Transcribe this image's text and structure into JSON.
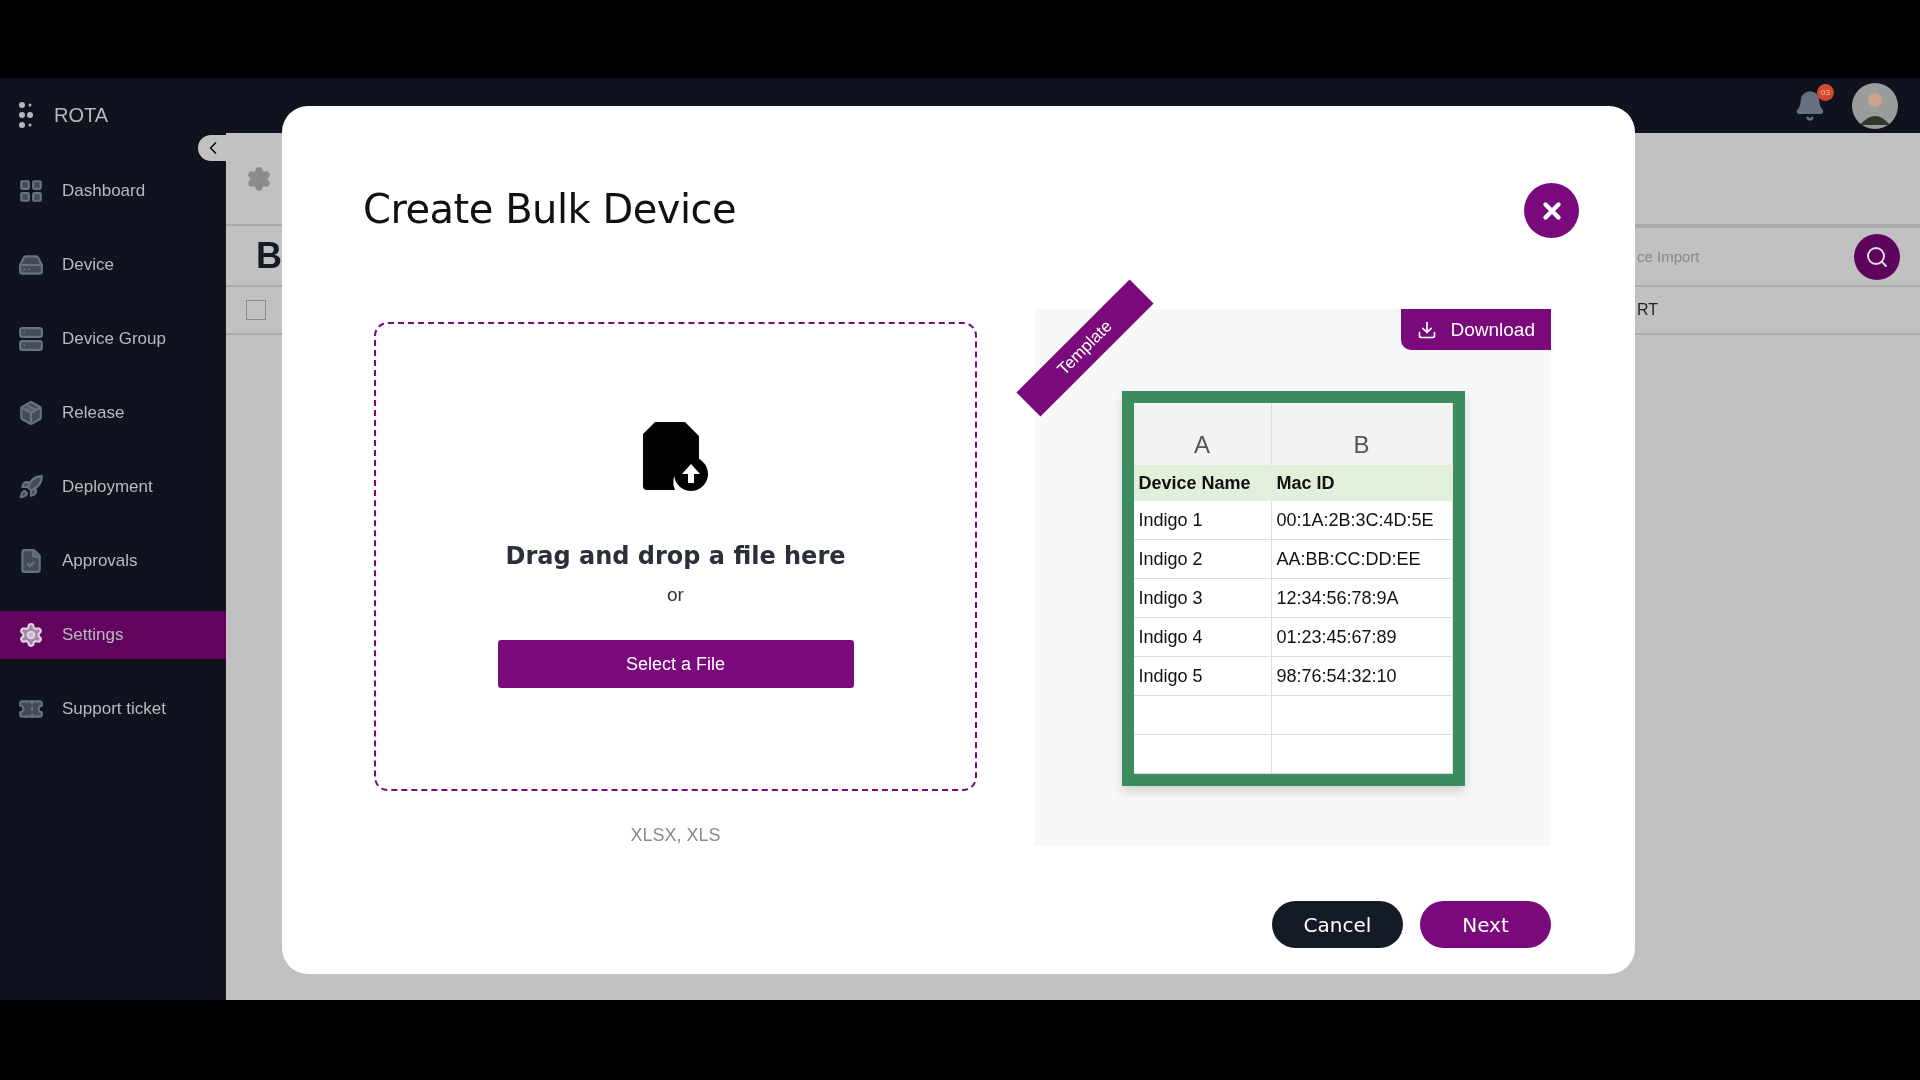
{
  "sidebar": {
    "brand": "ROTA",
    "items": [
      {
        "label": "Dashboard",
        "selected": false
      },
      {
        "label": "Device",
        "selected": false
      },
      {
        "label": "Device Group",
        "selected": false
      },
      {
        "label": "Release",
        "selected": false
      },
      {
        "label": "Deployment",
        "selected": false
      },
      {
        "label": "Approvals",
        "selected": false
      },
      {
        "label": "Settings",
        "selected": true
      },
      {
        "label": "Support ticket",
        "selected": false
      }
    ]
  },
  "header": {
    "notification_count": "03"
  },
  "background_page": {
    "title_fragment": "B",
    "search_placeholder_fragment": "ce Import",
    "column_fragment": "RT",
    "select_all_checked": false
  },
  "modal": {
    "title": "Create Bulk Device",
    "dropzone": {
      "prompt": "Drag and drop a file here",
      "separator": "or",
      "button": "Select a File"
    },
    "formats": "XLSX, XLS",
    "template": {
      "ribbon": "Template",
      "download": "Download",
      "columns": [
        "A",
        "B"
      ],
      "header": [
        "Device Name",
        "Mac ID"
      ],
      "rows": [
        [
          "Indigo 1",
          "00:1A:2B:3C:4D:5E"
        ],
        [
          "Indigo 2",
          "AA:BB:CC:DD:EE"
        ],
        [
          "Indigo 3",
          "12:34:56:78:9A"
        ],
        [
          "Indigo 4",
          "01:23:45:67:89"
        ],
        [
          "Indigo 5",
          "98:76:54:32:10"
        ]
      ]
    },
    "buttons": {
      "cancel": "Cancel",
      "next": "Next"
    }
  }
}
